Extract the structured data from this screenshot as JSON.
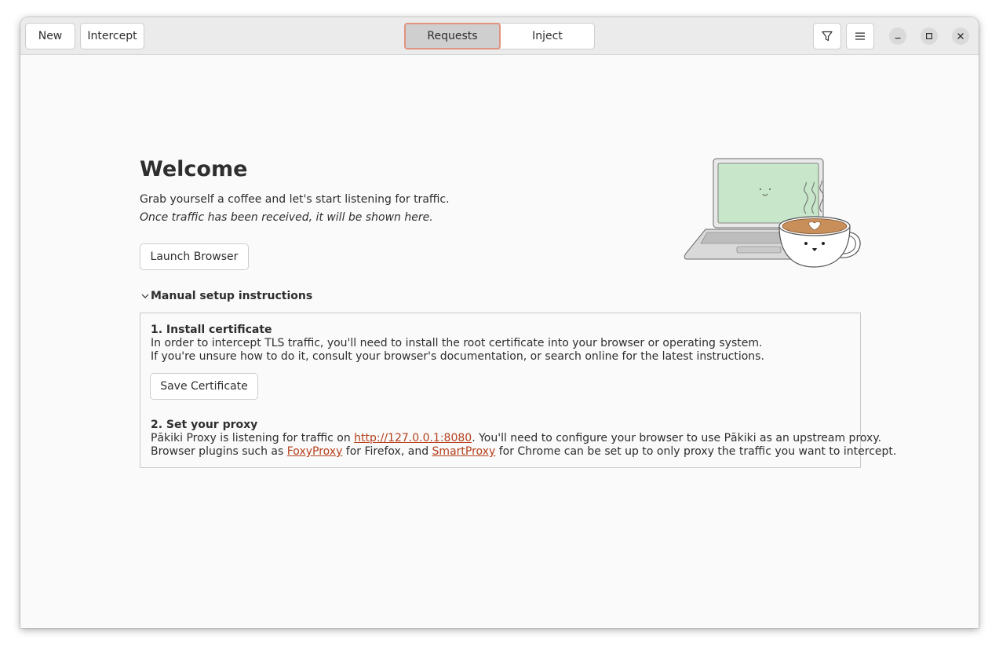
{
  "headerbar": {
    "new_label": "New",
    "intercept_label": "Intercept",
    "tabs": [
      {
        "label": "Requests",
        "active": true
      },
      {
        "label": "Inject",
        "active": false
      }
    ],
    "filter_icon": "filter-icon",
    "menu_icon": "hamburger-menu-icon",
    "minimize_icon": "minimize-icon",
    "maximize_icon": "maximize-icon",
    "close_icon": "close-icon"
  },
  "welcome": {
    "title": "Welcome",
    "subtitle": "Grab yourself a coffee and let's start listening for traffic.",
    "note": "Once traffic has been received, it will be shown here.",
    "launch_browser_label": "Launch Browser",
    "illustration": "laptop-and-coffee-cup-illustration"
  },
  "manual_setup": {
    "expander_label": "Manual setup instructions",
    "expanded": true,
    "step1": {
      "heading": "1. Install certificate",
      "line1": "In order to intercept TLS traffic, you'll need to install the root certificate into your browser or operating system.",
      "line2": "If you're unsure how to do it, consult your browser's documentation, or search online for the latest instructions.",
      "save_certificate_label": "Save Certificate"
    },
    "step2": {
      "heading": "2. Set your proxy",
      "line1_prefix": "Pākiki Proxy is listening for traffic on ",
      "proxy_link": "http://127.0.0.1:8080",
      "line1_suffix": ". You'll need to configure your browser to use Pākiki as an upstream proxy.",
      "line2_prefix": "Browser plugins such as ",
      "foxyproxy_link": "FoxyProxy",
      "line2_middle": " for Firefox, and ",
      "smartproxy_link": "SmartProxy",
      "line2_suffix": " for Chrome can be set up to only proxy the traffic you want to intercept."
    }
  },
  "colors": {
    "accent_border": "#e0947e",
    "link": "#b5401c",
    "laptop_screen": "#c8e6c9",
    "coffee": "#c98f5a"
  }
}
